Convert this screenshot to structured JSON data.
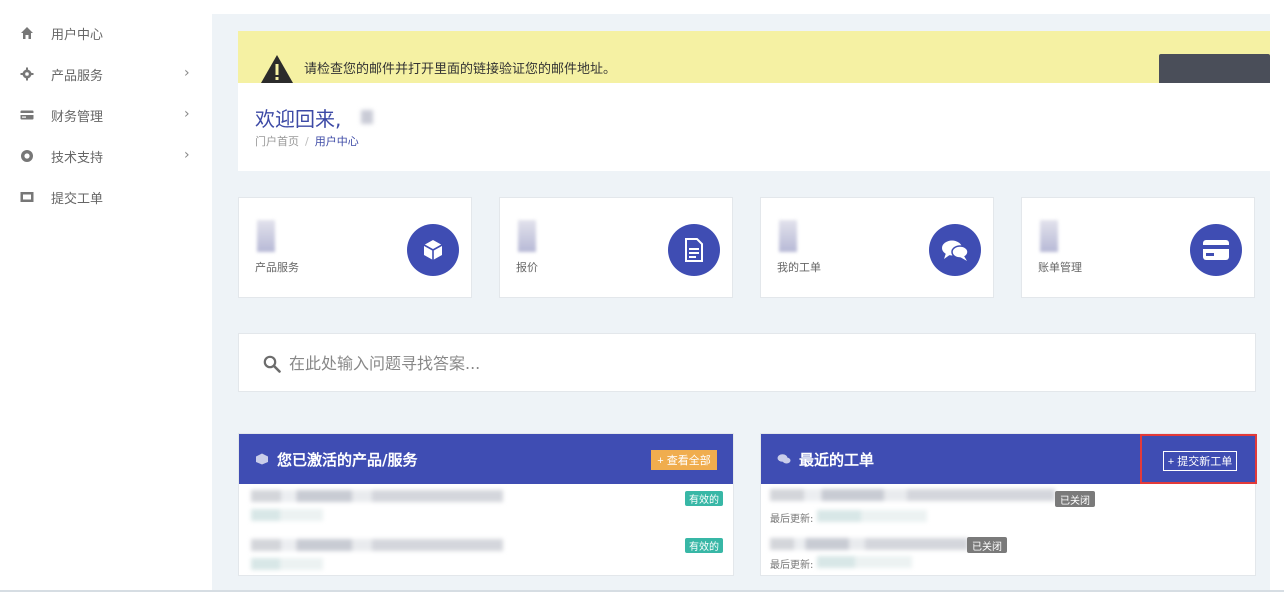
{
  "sidebar": {
    "items": [
      {
        "label": "用户中心",
        "icon": "home-icon",
        "has_chevron": false
      },
      {
        "label": "产品服务",
        "icon": "gear-icon",
        "has_chevron": true
      },
      {
        "label": "财务管理",
        "icon": "credit-card-icon",
        "has_chevron": true
      },
      {
        "label": "技术支持",
        "icon": "lifebuoy-icon",
        "has_chevron": true
      },
      {
        "label": "提交工单",
        "icon": "ticket-icon",
        "has_chevron": false
      }
    ],
    "chevron": "›"
  },
  "alert": {
    "message": "请检查您的邮件并打开里面的链接验证您的邮件地址。",
    "icon": "warning-icon"
  },
  "welcome": {
    "title": "欢迎回来,",
    "breadcrumb": {
      "home": "门户首页",
      "separator": "/",
      "current": "用户中心"
    }
  },
  "stats": [
    {
      "label": "产品服务",
      "icon": "cube-icon"
    },
    {
      "label": "报价",
      "icon": "document-icon"
    },
    {
      "label": "我的工单",
      "icon": "comments-icon"
    },
    {
      "label": "账单管理",
      "icon": "credit-card-icon"
    }
  ],
  "search": {
    "placeholder": "在此处输入问题寻找答案..."
  },
  "products_panel": {
    "title": "您已激活的产品/服务",
    "view_all_label": "+ 查看全部",
    "rows": [
      {
        "status": "有效的"
      },
      {
        "status": "有效的"
      }
    ]
  },
  "tickets_panel": {
    "title": "最近的工单",
    "new_ticket_label": "+ 提交新工单",
    "rows": [
      {
        "status": "已关闭",
        "updated_label": "最后更新:"
      },
      {
        "status": "已关闭",
        "updated_label": "最后更新:"
      }
    ]
  },
  "colors": {
    "accent": "#3f4db3",
    "alert_bg": "#f5f1a3",
    "active_badge": "#38b7a6",
    "closed_badge": "#7a7a7a",
    "view_all": "#f0ad4e",
    "highlight_box": "#e23a3a"
  }
}
